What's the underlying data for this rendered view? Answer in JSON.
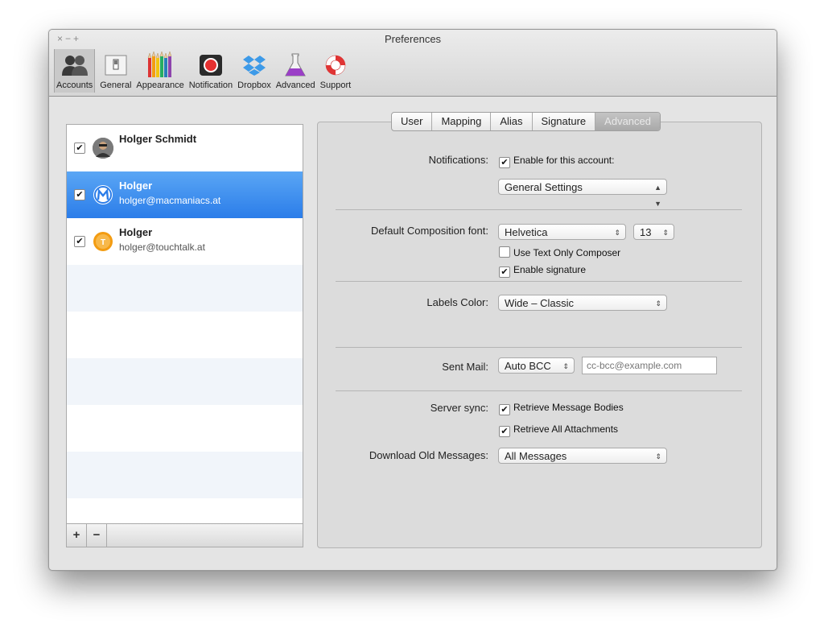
{
  "window": {
    "title": "Preferences",
    "controls": [
      "×",
      "−",
      "+"
    ]
  },
  "toolbar": {
    "items": [
      {
        "label": "Accounts",
        "icon": "accounts-icon"
      },
      {
        "label": "General",
        "icon": "general-switch-icon"
      },
      {
        "label": "Appearance",
        "icon": "pencils-icon"
      },
      {
        "label": "Notification",
        "icon": "record-icon"
      },
      {
        "label": "Dropbox",
        "icon": "dropbox-icon"
      },
      {
        "label": "Advanced",
        "icon": "flask-icon"
      },
      {
        "label": "Support",
        "icon": "lifebuoy-icon"
      }
    ],
    "selected": "Accounts"
  },
  "accounts": [
    {
      "name": "Holger Schmidt",
      "email": "",
      "checked": true
    },
    {
      "name": "Holger",
      "email": "holger@macmaniacs.at",
      "checked": true
    },
    {
      "name": "Holger",
      "email": "holger@touchtalk.at",
      "checked": true
    }
  ],
  "list_buttons": {
    "add": "+",
    "remove": "−"
  },
  "tabs": [
    "User",
    "Mapping",
    "Alias",
    "Signature",
    "Advanced"
  ],
  "active_tab": "Advanced",
  "form": {
    "notifications_label": "Notifications:",
    "enable_account": "Enable for this account:",
    "general_settings": "General Settings",
    "font_label": "Default Composition font:",
    "font_value": "Helvetica",
    "font_size": "13",
    "text_only": "Use Text Only Composer",
    "enable_signature": "Enable signature",
    "labels_color_label": "Labels Color:",
    "labels_color_value": "Wide – Classic",
    "sent_mail_label": "Sent Mail:",
    "sent_mail_value": "Auto BCC",
    "bcc_placeholder": "cc-bcc@example.com",
    "server_sync_label": "Server sync:",
    "retrieve_bodies": "Retrieve Message Bodies",
    "retrieve_attachments": "Retrieve All Attachments",
    "download_label": "Download Old Messages:",
    "download_value": "All Messages"
  },
  "checkbox_states": {
    "enable_account": true,
    "text_only": false,
    "enable_signature": true,
    "retrieve_bodies": true,
    "retrieve_attachments": true
  },
  "colors": {
    "selection": "#2b7de9",
    "stripe": "#f1f5fa",
    "window_bg": "#e4e4e4"
  }
}
